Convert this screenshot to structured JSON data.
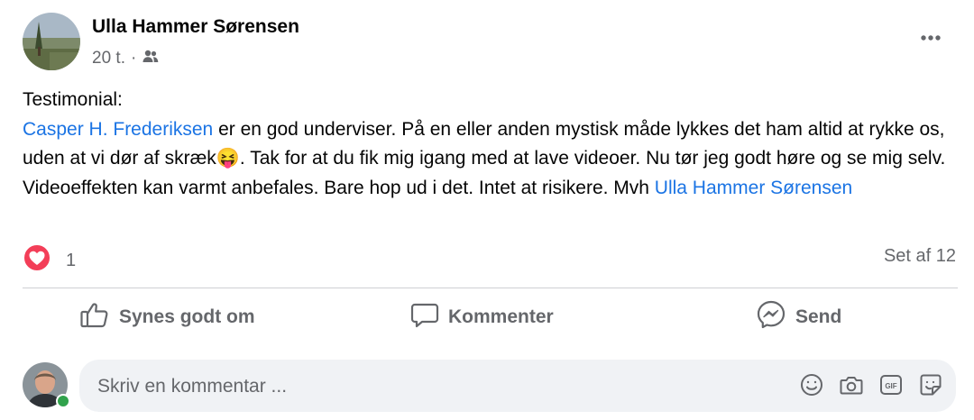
{
  "post": {
    "author": "Ulla Hammer Sørensen",
    "time": "20 t.",
    "separator": "·",
    "line_heading": "Testimonial:",
    "mention": "Casper H. Frederiksen",
    "text_part1": " er en god underviser. På en eller anden mystisk måde lykkes det ham altid at rykke os, uden at vi dør af skræk",
    "emoji": "😝",
    "text_part2": ". Tak for at du fik mig igang med at lave videoer. Nu tør jeg godt høre og se mig selv. Videoeffekten kan varmt anbefales. Bare hop ud i det. Intet at risikere. Mvh ",
    "signature_link": "Ulla Hammer Sørensen"
  },
  "reactions": {
    "count": "1",
    "views": "Set af 12"
  },
  "actions": {
    "like": "Synes godt om",
    "comment": "Kommenter",
    "send": "Send"
  },
  "comment": {
    "placeholder": "Skriv en kommentar ..."
  },
  "colors": {
    "link": "#1b74e4",
    "secondary_text": "#65676b",
    "love_red": "#f33e58",
    "online_green": "#31a24c"
  },
  "icons": {
    "privacy": "friends-icon",
    "more": "more-horizontal-icon",
    "reaction": "love-reaction-icon",
    "like": "thumbs-up-icon",
    "comment": "comment-bubble-icon",
    "send": "messenger-icon",
    "emoji": "emoji-icon",
    "camera": "camera-icon",
    "gif": "gif-icon",
    "sticker": "sticker-icon"
  }
}
